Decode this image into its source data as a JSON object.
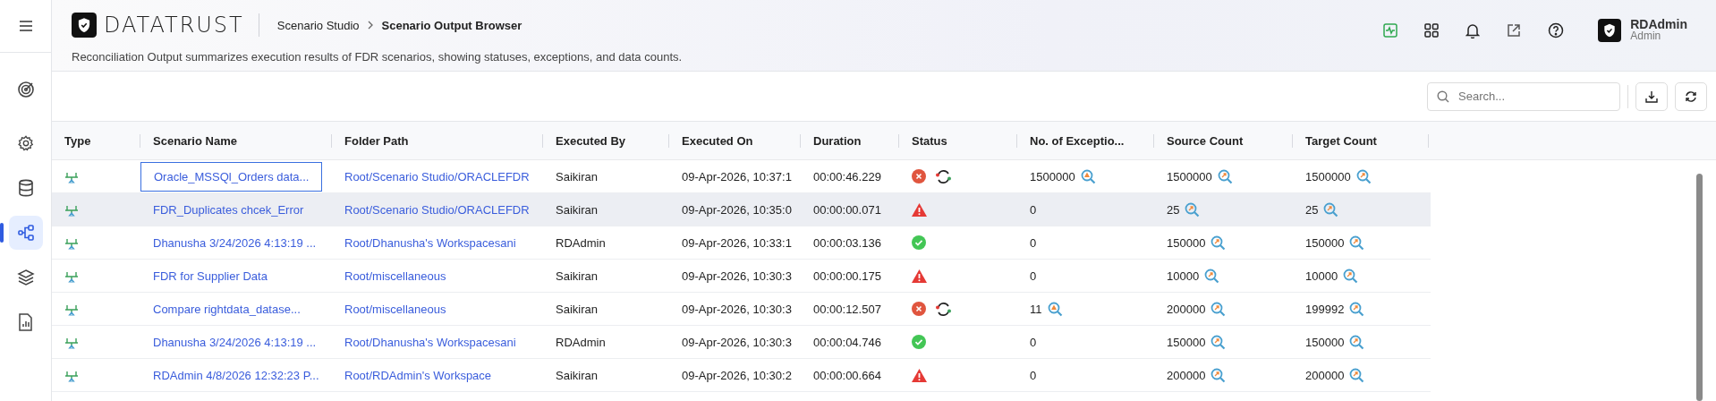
{
  "sidebar": {
    "items": [
      {
        "kind": "menu",
        "selected": false
      },
      {
        "kind": "target",
        "selected": false
      },
      {
        "kind": "gear",
        "selected": false
      },
      {
        "kind": "database",
        "selected": false
      },
      {
        "kind": "flow",
        "selected": true
      },
      {
        "kind": "layers",
        "selected": false
      },
      {
        "kind": "report",
        "selected": false
      }
    ]
  },
  "header": {
    "logo": "DATATRUST",
    "breadcrumb": [
      "Scenario Studio",
      "Scenario Output Browser"
    ],
    "description": "Reconciliation Output summarizes execution results of FDR scenarios, showing statuses, exceptions, and data counts.",
    "icons": [
      {
        "kind": "activity"
      },
      {
        "kind": "grid"
      },
      {
        "kind": "bell"
      },
      {
        "kind": "external"
      },
      {
        "kind": "help"
      }
    ],
    "user": {
      "name": "RDAdmin",
      "role": "Admin"
    }
  },
  "toolbar": {
    "search": {
      "placeholder": "Search..."
    }
  },
  "table": {
    "columns": [
      "Type",
      "Scenario Name",
      "Folder Path",
      "Executed By",
      "Executed On",
      "Duration",
      "Status",
      "No. of Exceptio...",
      "Source Count",
      "Target Count"
    ],
    "rows": [
      {
        "highlighted": false,
        "name_focused": true,
        "name": "Oracle_MSSQl_Orders data...",
        "folder": "Root/Scenario Studio/ORACLEFDR",
        "executed_by": "Saikiran",
        "executed_on": "09-Apr-2026, 10:37:1",
        "duration": "00:00:46.229",
        "status": {
          "kind": "failed"
        },
        "rerun": true,
        "exceptions": "1500000",
        "exceptions_inspect": true,
        "source": "1500000",
        "target": "1500000"
      },
      {
        "highlighted": true,
        "name_focused": false,
        "name": "FDR_Duplicates chcek_Error",
        "folder": "Root/Scenario Studio/ORACLEFDR",
        "executed_by": "Saikiran",
        "executed_on": "09-Apr-2026, 10:35:0",
        "duration": "00:00:00.071",
        "status": {
          "kind": "error"
        },
        "rerun": false,
        "exceptions": "0",
        "exceptions_inspect": false,
        "source": "25",
        "target": "25"
      },
      {
        "highlighted": false,
        "name_focused": false,
        "name": "Dhanusha 3/24/2026 4:13:19 ...",
        "folder": "Root/Dhanusha's Workspacesani",
        "executed_by": "RDAdmin",
        "executed_on": "09-Apr-2026, 10:33:1",
        "duration": "00:00:03.136",
        "status": {
          "kind": "passed"
        },
        "rerun": false,
        "exceptions": "0",
        "exceptions_inspect": false,
        "source": "150000",
        "target": "150000"
      },
      {
        "highlighted": false,
        "name_focused": false,
        "name": "FDR for Supplier Data",
        "folder": "Root/miscellaneous",
        "executed_by": "Saikiran",
        "executed_on": "09-Apr-2026, 10:30:3",
        "duration": "00:00:00.175",
        "status": {
          "kind": "error"
        },
        "rerun": false,
        "exceptions": "0",
        "exceptions_inspect": false,
        "source": "10000",
        "target": "10000"
      },
      {
        "highlighted": false,
        "name_focused": false,
        "name": "Compare rightdata_datase...",
        "folder": "Root/miscellaneous",
        "executed_by": "Saikiran",
        "executed_on": "09-Apr-2026, 10:30:3",
        "duration": "00:00:12.507",
        "status": {
          "kind": "failed"
        },
        "rerun": true,
        "exceptions": "11",
        "exceptions_inspect": true,
        "source": "200000",
        "target": "199992"
      },
      {
        "highlighted": false,
        "name_focused": false,
        "name": "Dhanusha 3/24/2026 4:13:19 ...",
        "folder": "Root/Dhanusha's Workspacesani",
        "executed_by": "RDAdmin",
        "executed_on": "09-Apr-2026, 10:30:3",
        "duration": "00:00:04.746",
        "status": {
          "kind": "passed"
        },
        "rerun": false,
        "exceptions": "0",
        "exceptions_inspect": false,
        "source": "150000",
        "target": "150000"
      },
      {
        "highlighted": false,
        "name_focused": false,
        "name": "RDAdmin 4/8/2026 12:32:23 P...",
        "folder": "Root/RDAdmin's Workspace",
        "executed_by": "Saikiran",
        "executed_on": "09-Apr-2026, 10:30:2",
        "duration": "00:00:00.664",
        "status": {
          "kind": "error"
        },
        "rerun": false,
        "exceptions": "0",
        "exceptions_inspect": false,
        "source": "200000",
        "target": "200000"
      }
    ]
  }
}
